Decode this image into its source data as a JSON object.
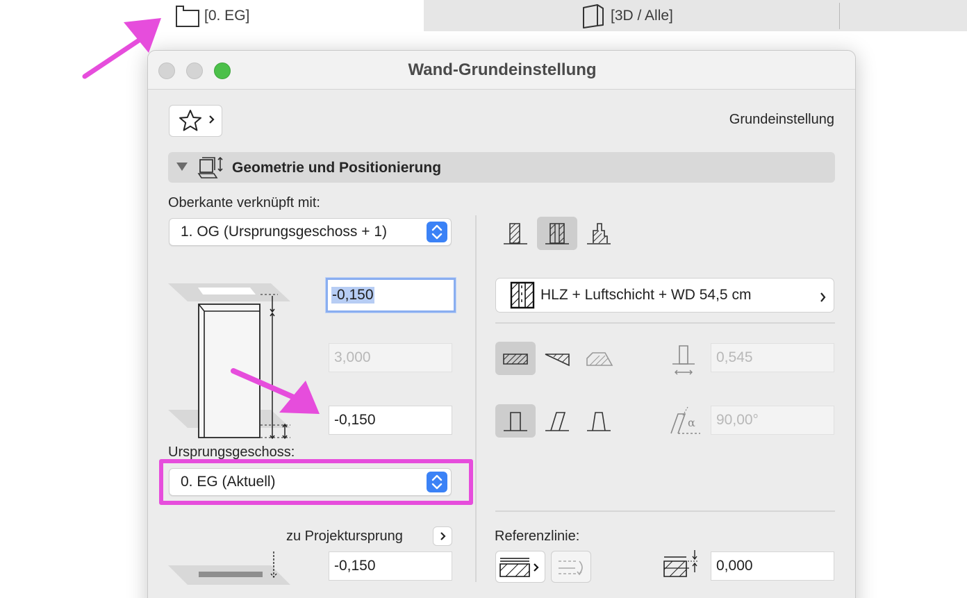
{
  "tabs": [
    {
      "label": "[0. EG]",
      "icon": "floor-plan-icon",
      "active": true
    },
    {
      "label": "[3D / Alle]",
      "icon": "3d-window-icon",
      "active": false
    }
  ],
  "window": {
    "title": "Wand-Grundeinstellung",
    "favorites_icon": "star-icon",
    "preset_label": "Grundeinstellung"
  },
  "section": {
    "title": "Geometrie und Positionierung",
    "icon": "geometry-position-icon"
  },
  "top_link": {
    "label": "Oberkante verknüpft mit:",
    "selected": "1. OG (Ursprungsgeschoss + 1)"
  },
  "fields": {
    "top_offset": "-0,150",
    "height": "3,000",
    "bottom_offset": "-0,150",
    "project_origin": "-0,150",
    "thickness": "0,545",
    "angle": "90,00°",
    "reference_offset": "0,000"
  },
  "home_story": {
    "label": "Ursprungsgeschoss:",
    "selected": "0. EG (Aktuell)"
  },
  "project_origin_label": "zu Projektursprung",
  "composite": {
    "label": "HLZ + Luftschicht + WD 54,5 cm",
    "icon": "composite-structure-icon"
  },
  "reference_line_label": "Referenzlinie:",
  "colors": {
    "accent_blue": "#3b82f6",
    "annotation_magenta": "#e64ddc",
    "focus_ring": "#8aaef0",
    "close": "#d4d4d4",
    "minimize": "#d4d4d4",
    "zoom": "#4cc04a"
  }
}
